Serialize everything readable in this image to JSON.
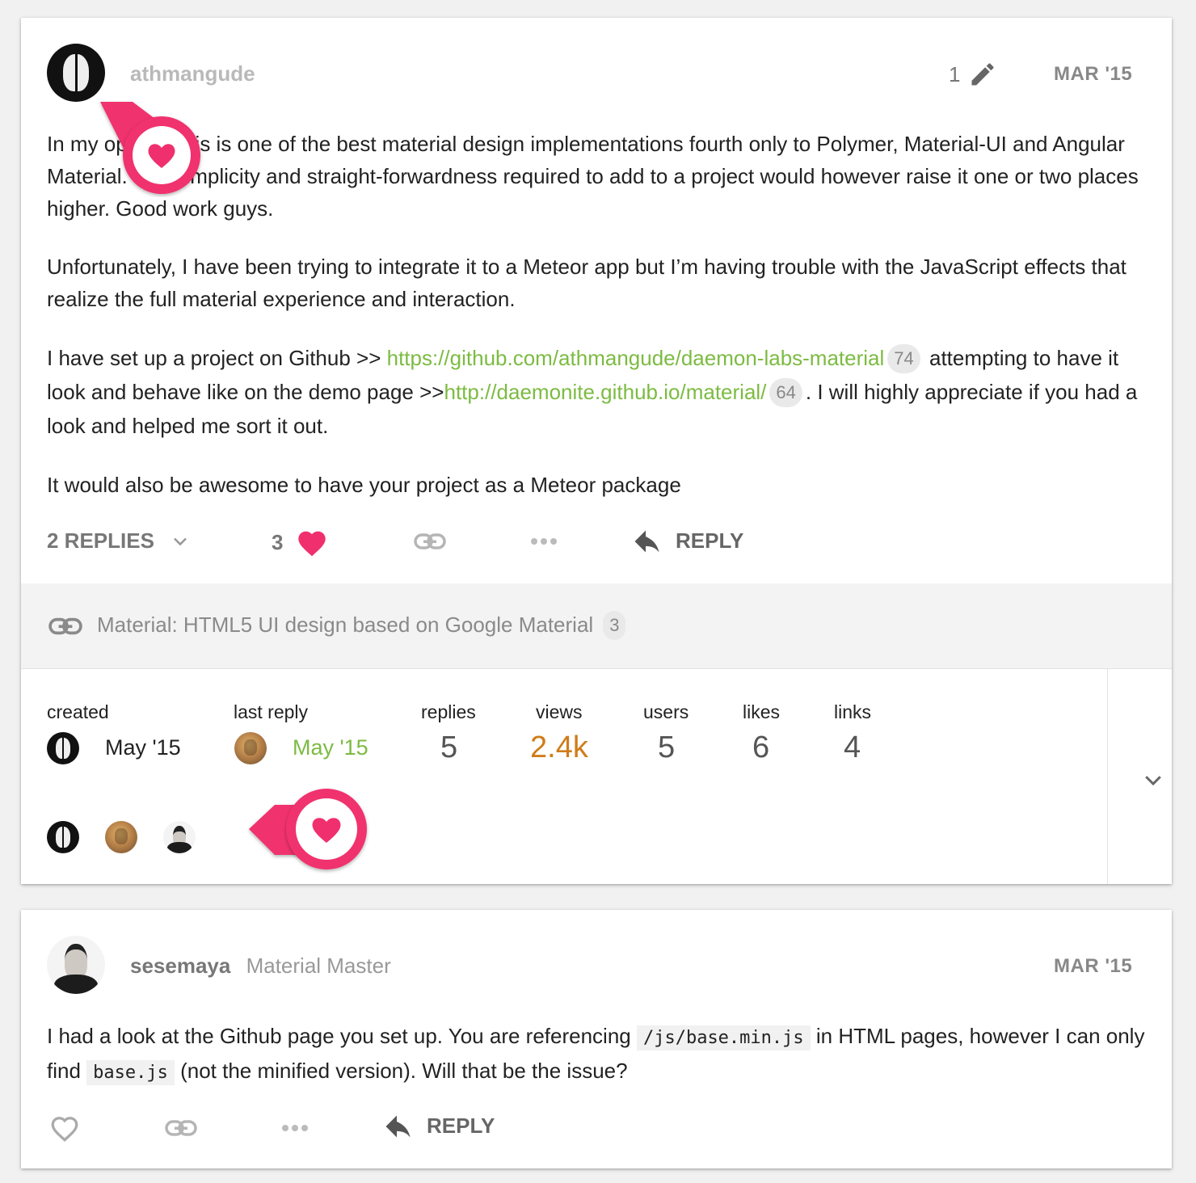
{
  "colors": {
    "accent_green": "#7cbb42",
    "heart_pink": "#f0306e",
    "views_orange": "#d07c1a"
  },
  "post1": {
    "username": "athmangude",
    "edit_count": "1",
    "date": "MAR '15",
    "paragraph1": "In my opinion this is one of the best material design implementations fourth only to Polymer, Material-UI and Angular Material. The simplicity and straight-forwardness required to add to a project would however raise it one or two places higher. Good work guys.",
    "paragraph2": "Unfortunately, I have been trying to integrate it to a Meteor app but I’m having trouble with the JavaScript effects that realize the full material experience and interaction.",
    "p3_before": "I have set up a project on Github >> ",
    "p3_link1": "https://github.com/athmangude/daemon-labs-material",
    "p3_link1_count": "74",
    "p3_mid": " attempting to have it look and behave like on the demo page >>",
    "p3_link2": "http://daemonite.github.io/material/",
    "p3_link2_count": "64",
    "p3_after": ". I will highly appreciate if you had a look and helped me sort it out.",
    "paragraph4": "It would also be awesome to have your project as a Meteor package",
    "replies_label": "2 REPLIES",
    "like_count": "3",
    "reply_label": "REPLY",
    "link_title": "Material: HTML5 UI design based on Google Material",
    "link_count": "3"
  },
  "topic_stats": {
    "created_label": "created",
    "created_date": "May '15",
    "last_reply_label": "last reply",
    "last_reply_date": "May '15",
    "replies_label": "replies",
    "replies_value": "5",
    "views_label": "views",
    "views_value": "2.4k",
    "users_label": "users",
    "users_value": "5",
    "likes_label": "likes",
    "likes_value": "6",
    "links_label": "links",
    "links_value": "4"
  },
  "post2": {
    "username": "sesemaya",
    "title": "Material Master",
    "date": "MAR '15",
    "t1": "I had a look at the Github page you set up. You are referencing ",
    "code1": "/js/base.min.js",
    "t2": " in HTML pages, however I can only find ",
    "code2": "base.js",
    "t3": " (not the minified version). Will that be the issue?",
    "reply_label": "REPLY"
  }
}
